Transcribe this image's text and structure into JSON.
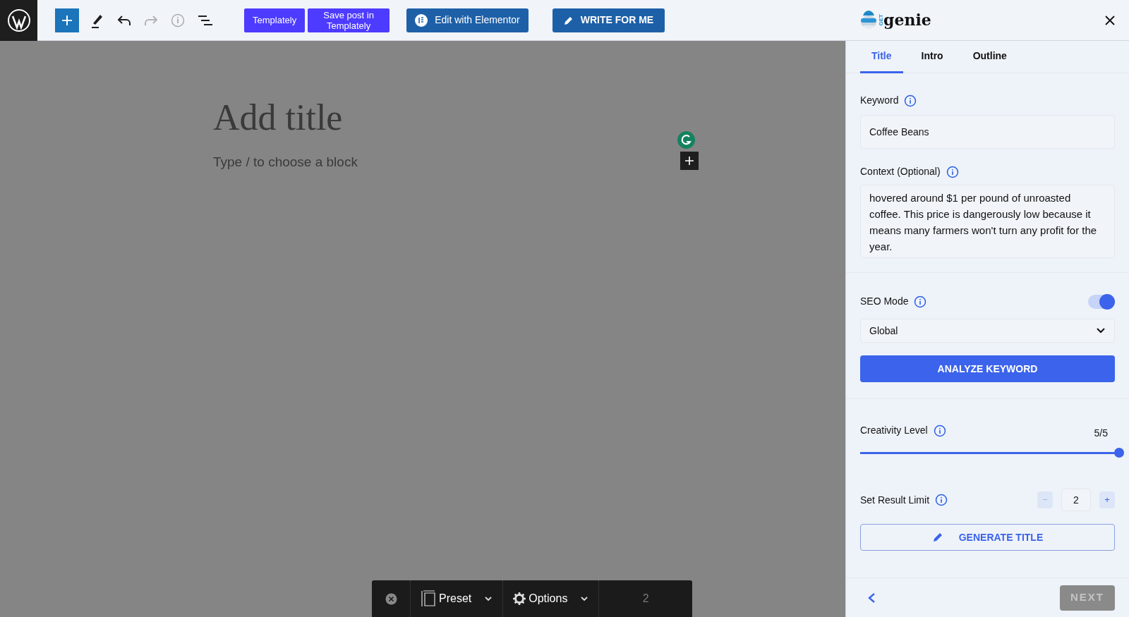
{
  "toolbar": {
    "buttons": [
      {
        "label": "Templately",
        "kind": "purple"
      },
      {
        "label": "Save post in Templately",
        "kind": "purple"
      },
      {
        "label": "Edit with Elementor",
        "kind": "elementor"
      },
      {
        "label": "WRITE FOR ME",
        "kind": "write"
      }
    ],
    "redo_disabled": true
  },
  "editor": {
    "title_placeholder": "Add title",
    "block_placeholder": "Type / to choose a block"
  },
  "block_toolbar": {
    "preset": "Preset",
    "options": "Options",
    "count": "2"
  },
  "sidebar": {
    "logo_small": "GET",
    "logo": "genie",
    "tabs": [
      {
        "label": "Title",
        "selected": true
      },
      {
        "label": "Intro",
        "selected": false
      },
      {
        "label": "Outline",
        "selected": false
      }
    ],
    "keyword": {
      "label": "Keyword",
      "value": "Coffee Beans"
    },
    "context": {
      "label": "Context (Optional)",
      "value": "hovered around $1 per pound of unroasted coffee. This price is dangerously low because it means many farmers won't turn any profit for the year."
    },
    "seo_mode": {
      "label": "SEO Mode",
      "on": true
    },
    "region": "Global",
    "analyze_button": "ANALYZE KEYWORD",
    "creativity": {
      "label": "Creativity Level",
      "reading": "5/5",
      "level": 1
    },
    "result_limit": {
      "label": "Set Result Limit",
      "value": "2",
      "minus": "−",
      "plus": "+"
    },
    "generate_button": "GENERATE TITLE",
    "next_button": {
      "label": "NEXT",
      "disabled": true
    }
  }
}
